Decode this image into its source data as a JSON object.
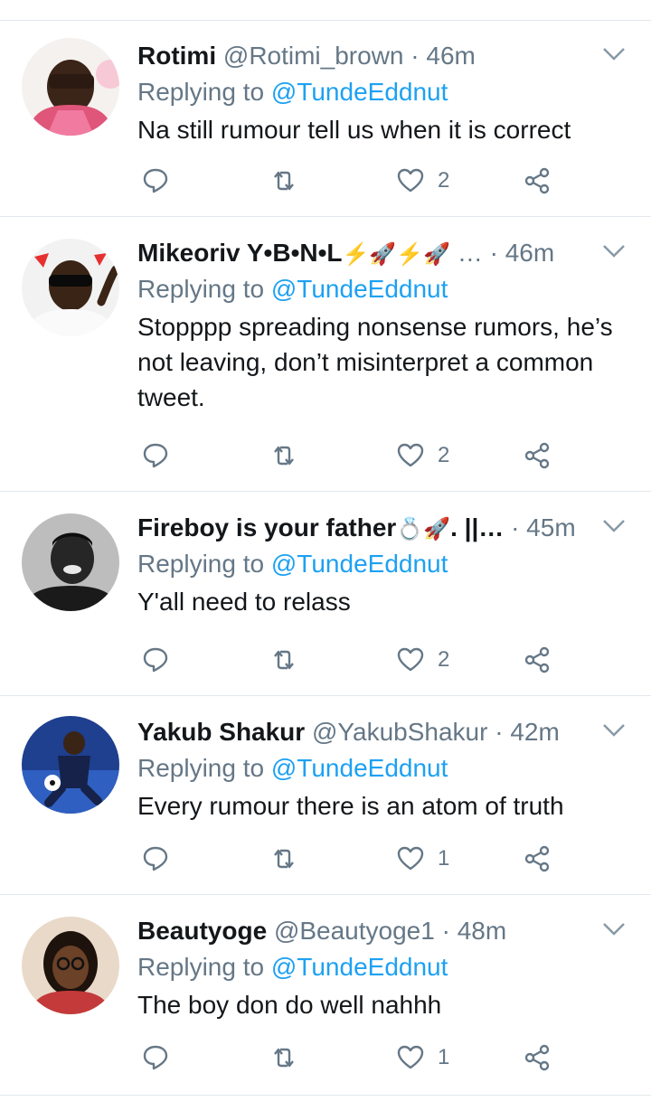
{
  "reply_prefix": "Replying to",
  "tweets": [
    {
      "name": "Rotimi",
      "handle": "@Rotimi_brown",
      "time": "· 46m",
      "replying_to": "@TundeEddnut",
      "text": "Na still rumour tell us when it is correct",
      "likes": "2"
    },
    {
      "name": "Mikeoriv Y•B•N•L",
      "name_emoji": "⚡🚀⚡🚀",
      "handle": "…",
      "time": "· 46m",
      "replying_to": "@TundeEddnut",
      "text": "Stopppp spreading nonsense rumors, he’s not leaving, don’t misinterpret a common tweet.",
      "likes": "2"
    },
    {
      "name": "Fireboy is your father",
      "name_emoji": "💍🚀",
      "name_suffix": ". ||…",
      "time": "· 45m",
      "replying_to": "@TundeEddnut",
      "text": "Y'all need to relass",
      "likes": "2"
    },
    {
      "name": "Yakub Shakur",
      "handle": "@YakubShakur",
      "time": "· 42m",
      "replying_to": "@TundeEddnut",
      "text": "Every rumour there is an atom of truth",
      "likes": "1"
    },
    {
      "name": "Beautyoge",
      "handle": "@Beautyoge1",
      "time": "· 48m",
      "replying_to": "@TundeEddnut",
      "text": "The boy don do well nahhh",
      "likes": "1"
    }
  ],
  "colors": {
    "link": "#1da1f2",
    "muted": "#657786",
    "divider": "#e1e8ed"
  }
}
